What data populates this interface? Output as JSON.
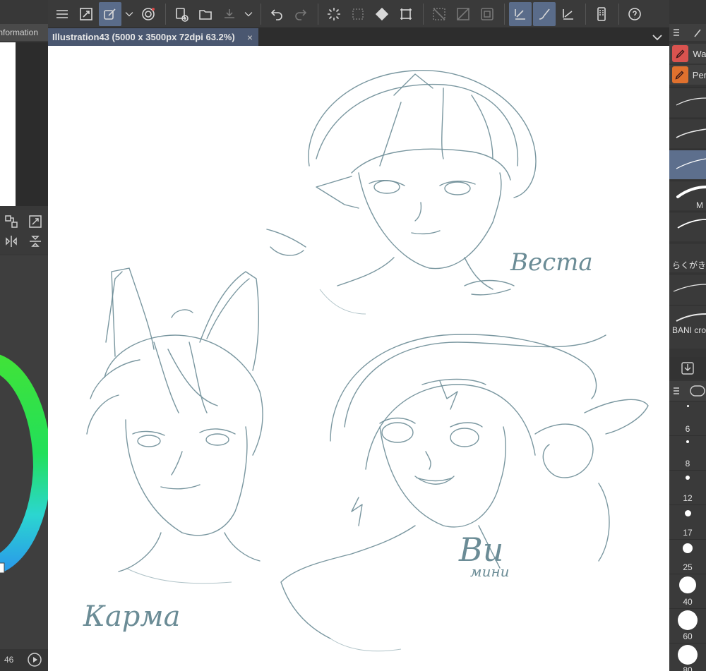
{
  "toolbar": {
    "icons": [
      "menu-icon",
      "fit-icon",
      "selection-tool-icon",
      "chevron-down-icon",
      "spiral-icon",
      "new-canvas-icon",
      "open-folder-icon",
      "save-icon",
      "chevron-down-icon",
      "undo-icon",
      "redo-icon",
      "loading-icon",
      "transform-icon",
      "fill-icon",
      "crop-icon",
      "clear-icon",
      "flip-icon",
      "frame-icon",
      "pen-settings-icon",
      "brush-settings-icon",
      "ruler-icon",
      "phone-icon",
      "help-icon"
    ]
  },
  "left_panel": {
    "tab_label": "Information",
    "brush_size_value": "46"
  },
  "document": {
    "tab_title": "Illustration43 (5000 x 3500px 72dpi 63.2%)",
    "close_symbol": "×"
  },
  "canvas": {
    "labels": [
      "Веста",
      "Карма",
      "Ви",
      "мини"
    ]
  },
  "right_panel": {
    "tools": [
      {
        "label": "Wa",
        "color": "#d9534f"
      },
      {
        "label": "Per",
        "color": "#e0712e"
      }
    ],
    "brushes": [
      {
        "label": ""
      },
      {
        "label": ""
      },
      {
        "label": ""
      },
      {
        "label": "M"
      },
      {
        "label": ""
      },
      {
        "label": "らくがき"
      },
      {
        "label": "BANI cro"
      }
    ],
    "sizes": [
      "6",
      "8",
      "12",
      "17",
      "25",
      "40",
      "60",
      "80"
    ]
  },
  "colors": {
    "toolbar_bg": "#3a3a3a",
    "active_button": "#5a6c8a",
    "tab_active": "#4a5770",
    "sketch_line": "#6b8c96",
    "canvas_bg": "#ffffff"
  }
}
